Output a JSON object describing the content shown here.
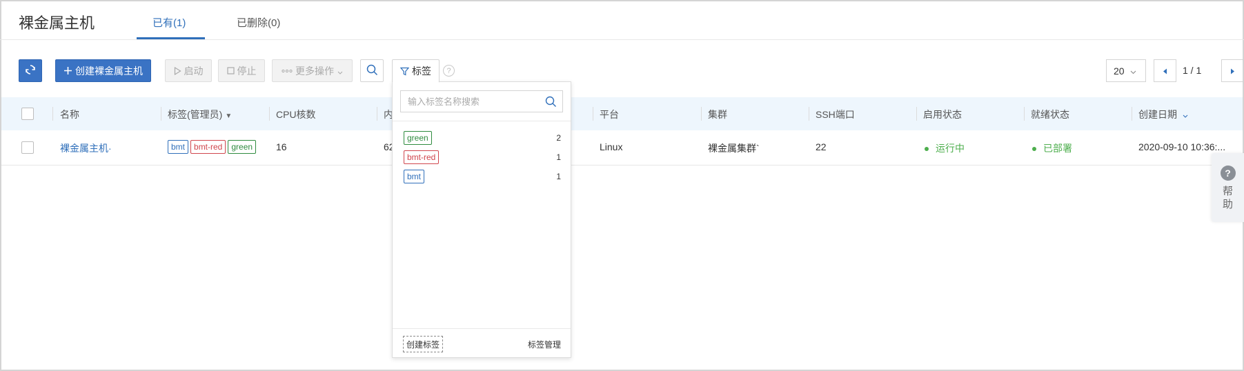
{
  "header": {
    "title": "裸金属主机",
    "tabs": [
      {
        "label": "已有(1)",
        "active": true
      },
      {
        "label": "已删除(0)",
        "active": false
      }
    ]
  },
  "toolbar": {
    "refresh_icon": "refresh-icon",
    "create_label": "创建裸金属主机",
    "start_label": "启动",
    "stop_label": "停止",
    "more_label": "更多操作",
    "search_icon": "search-icon",
    "tag_label": "标签",
    "help_glyph": "?"
  },
  "pagination": {
    "page_size": "20",
    "page_indicator": "1 / 1"
  },
  "table": {
    "columns": [
      "名称",
      "标签(管理员)",
      "CPU核数",
      "内",
      "平台",
      "集群",
      "SSH端口",
      "启用状态",
      "就绪状态",
      "创建日期"
    ],
    "rows": [
      {
        "name": "裸金属主机·",
        "tags": [
          {
            "text": "bmt",
            "color": "#2f6fba"
          },
          {
            "text": "bmt-red",
            "color": "#d0454c"
          },
          {
            "text": "green",
            "color": "#2e8b3e"
          }
        ],
        "cpu": "16",
        "memory": "62",
        "platform": "Linux",
        "cluster": "裸金属集群`",
        "ssh_port": "22",
        "enable_status": "运行中",
        "ready_status": "已部署",
        "created": "2020-09-10 10:36:..."
      }
    ]
  },
  "tag_dropdown": {
    "search_placeholder": "输入标签名称搜索",
    "items": [
      {
        "text": "green",
        "count": "2",
        "color": "#2e8b3e"
      },
      {
        "text": "bmt-red",
        "count": "1",
        "color": "#d0454c"
      },
      {
        "text": "bmt",
        "count": "1",
        "color": "#2f6fba"
      }
    ],
    "create_label": "创建标签",
    "manage_label": "标签管理"
  },
  "help_widget": {
    "glyph": "?",
    "label": "帮助"
  },
  "colors": {
    "accent": "#3a73c4",
    "link": "#2f6fba",
    "success": "#4cae4c",
    "header_bg": "#eef6fd"
  }
}
